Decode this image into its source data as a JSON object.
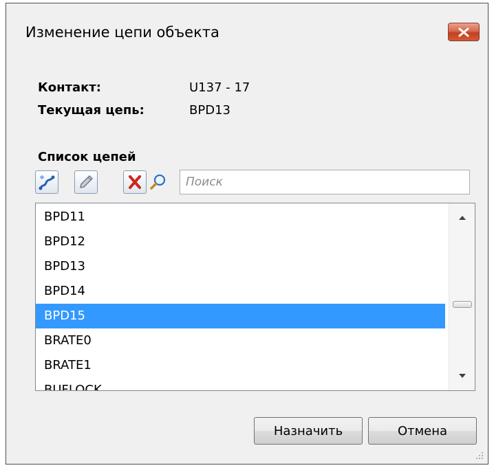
{
  "dialog": {
    "title": "Изменение цепи объекта",
    "close_icon": "close-x-icon"
  },
  "info": {
    "contact_label": "Контакт:",
    "contact_value": "U137 - 17",
    "current_chain_label": "Текущая цепь:",
    "current_chain_value": "BPD13"
  },
  "chain_list": {
    "label": "Список цепей",
    "toolbar": {
      "new_icon": "new-chain-icon",
      "edit_icon": "pencil-edit-icon",
      "delete_icon": "delete-x-icon",
      "search_icon": "magnifier-icon"
    },
    "search": {
      "placeholder": "Поиск",
      "value": ""
    },
    "items": [
      "BPD11",
      "BPD12",
      "BPD13",
      "BPD14",
      "BPD15",
      "BRATE0",
      "BRATE1",
      "BUFLOCK"
    ],
    "selected": "BPD15"
  },
  "buttons": {
    "assign": "Назначить",
    "cancel": "Отмена"
  },
  "colors": {
    "selection": "#3399ff",
    "window_bg": "#f0f0f0",
    "close_button": "#c74a2c"
  }
}
